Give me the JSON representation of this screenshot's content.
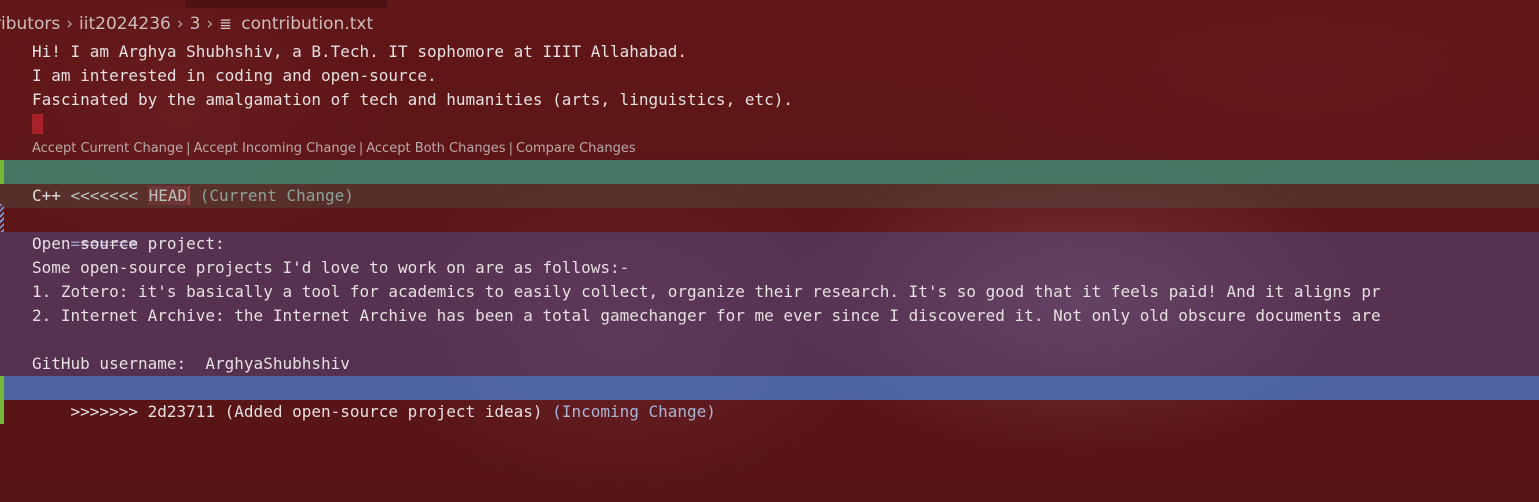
{
  "breadcrumb": {
    "segments": [
      "ributors",
      "iit2024236",
      "3"
    ],
    "file_icon": "text-file-icon",
    "file_name": "contribution.txt"
  },
  "editor": {
    "intro_lines": [
      "Hi! I am Arghya Shubhshiv, a B.Tech. IT sophomore at IIIT Allahabad.",
      "I am interested in coding and open-source.",
      "Fascinated by the amalgamation of tech and humanities (arts, linguistics, etc)."
    ],
    "codelens": {
      "accept_current": "Accept Current Change",
      "accept_incoming": "Accept Incoming Change",
      "accept_both": "Accept Both Changes",
      "compare": "Compare Changes",
      "separator": "|"
    },
    "conflict": {
      "current_marker": "<<<<<<< ",
      "current_ref": "HEAD",
      "current_hint": " (Current Change)",
      "current_lines": [
        "C++"
      ],
      "divider": "=======",
      "incoming_lines": [
        "Open source project:",
        "Some open-source projects I'd love to work on are as follows:-",
        "1. Zotero: it's basically a tool for academics to easily collect, organize their research. It's so good that it feels paid! And it aligns pr",
        "2. Internet Archive: the Internet Archive has been a total gamechanger for me ever since I discovered it. Not only old obscure documents are",
        "",
        "GitHub username:  ArghyaShubhshiv"
      ],
      "incoming_marker": ">>>>>>> 2d23711 (Added open-source project ideas)",
      "incoming_hint": " (Incoming Change)"
    }
  },
  "colors": {
    "background": "#5a1416",
    "current_header": "#40917a",
    "incoming_header": "#4a78c4",
    "incoming_body": "#50549a",
    "gutter_added": "#76b83a"
  }
}
